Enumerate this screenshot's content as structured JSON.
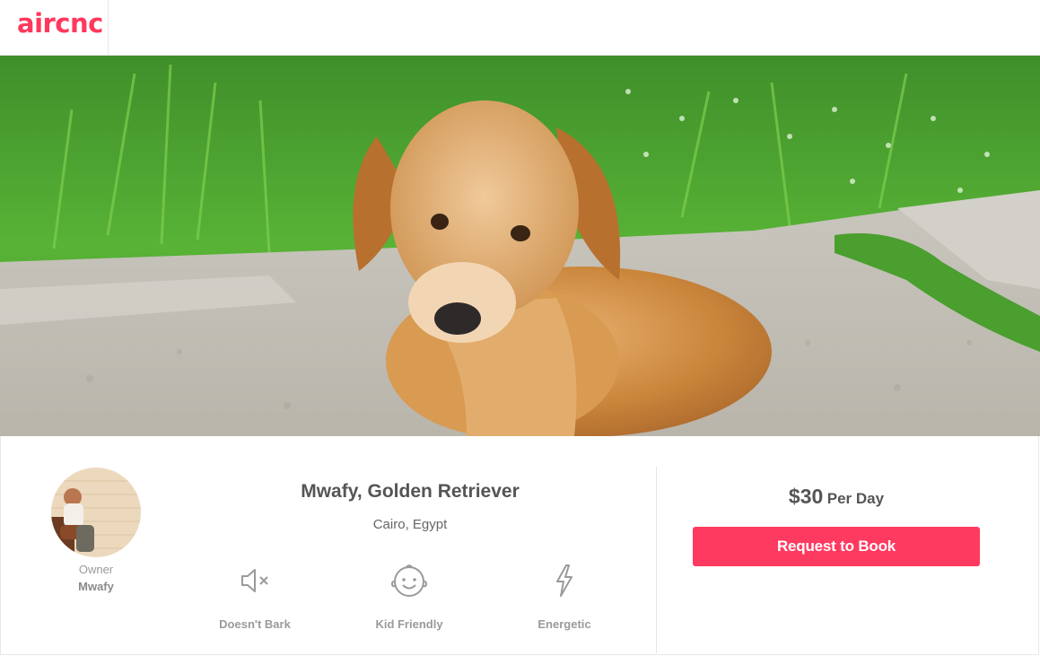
{
  "brand": {
    "logo_text": "aircnc",
    "color": "#ff385c"
  },
  "hero": {
    "image": "golden-retriever-on-path-photo"
  },
  "owner": {
    "label": "Owner",
    "name": "Mwafy",
    "avatar": "owner-photo"
  },
  "listing": {
    "title": "Mwafy, Golden Retriever",
    "location": "Cairo, Egypt",
    "features": [
      {
        "icon": "muted-speaker-icon",
        "label": "Doesn't Bark"
      },
      {
        "icon": "smiling-baby-icon",
        "label": "Kid Friendly"
      },
      {
        "icon": "lightning-bolt-icon",
        "label": "Energetic"
      }
    ]
  },
  "booking": {
    "price": "$30",
    "unit": "Per Day",
    "button_label": "Request to Book",
    "button_color": "#ff3a60"
  }
}
